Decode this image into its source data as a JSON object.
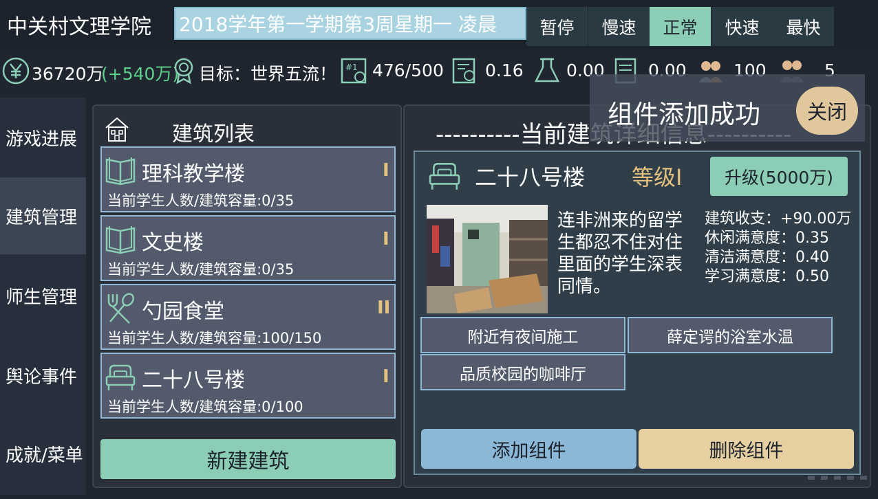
{
  "header": {
    "school_name": "中关村文理学院",
    "date_time": "2018学年第一学期第3周星期一 凌晨",
    "speed_buttons": [
      "暂停",
      "慢速",
      "正常",
      "快速",
      "最快"
    ],
    "active_speed": "正常"
  },
  "stats": {
    "money": "36720万",
    "money_delta": "(+540万)",
    "goal": "目标：世界五流！",
    "capacity": "476/500",
    "research": "0.16",
    "science": "0.00",
    "papers": "0.00",
    "teachers": "100",
    "students": "5"
  },
  "sidebar": {
    "items": [
      {
        "label": "游戏进展"
      },
      {
        "label": "建筑管理"
      },
      {
        "label": "师生管理"
      },
      {
        "label": "舆论事件"
      },
      {
        "label": "成就/菜单"
      }
    ],
    "active_index": 1
  },
  "building_list": {
    "title": "建筑列表",
    "items": [
      {
        "name": "理科教学楼",
        "capacity": "当前学生人数/建筑容量:0/35",
        "level": "I",
        "icon": "book-icon"
      },
      {
        "name": "文史楼",
        "capacity": "当前学生人数/建筑容量:0/35",
        "level": "I",
        "icon": "book-icon"
      },
      {
        "name": "勺园食堂",
        "capacity": "当前学生人数/建筑容量:100/150",
        "level": "II",
        "icon": "fork-spoon-icon"
      },
      {
        "name": "二十八号楼",
        "capacity": "当前学生人数/建筑容量:0/100",
        "level": "I",
        "icon": "bed-icon"
      }
    ],
    "new_button": "新建建筑"
  },
  "detail": {
    "title": "----------当前建筑详细信息----------",
    "building_name": "二十八号楼",
    "level": "等级I",
    "upgrade_button": "升级(5000万)",
    "description": "连非洲来的留学生都忍不住对住里面的学生深表同情。",
    "metrics": [
      "建筑收支：+90.00万",
      "休闲满意度：0.35",
      "清洁满意度：0.40",
      "学习满意度：0.50"
    ],
    "components": [
      "附近有夜间施工",
      "薛定谔的浴室水温",
      "品质校园的咖啡厅"
    ],
    "add_button": "添加组件",
    "delete_button": "删除组件"
  },
  "toast": {
    "message": "组件添加成功",
    "close_button": "关闭"
  },
  "colors": {
    "accent_green": "#8ccdb5",
    "accent_blue": "#8cb8d8",
    "accent_tan": "#e6cfa0",
    "level_gold": "#e3c07f",
    "money_delta_green": "#5ed08a"
  }
}
